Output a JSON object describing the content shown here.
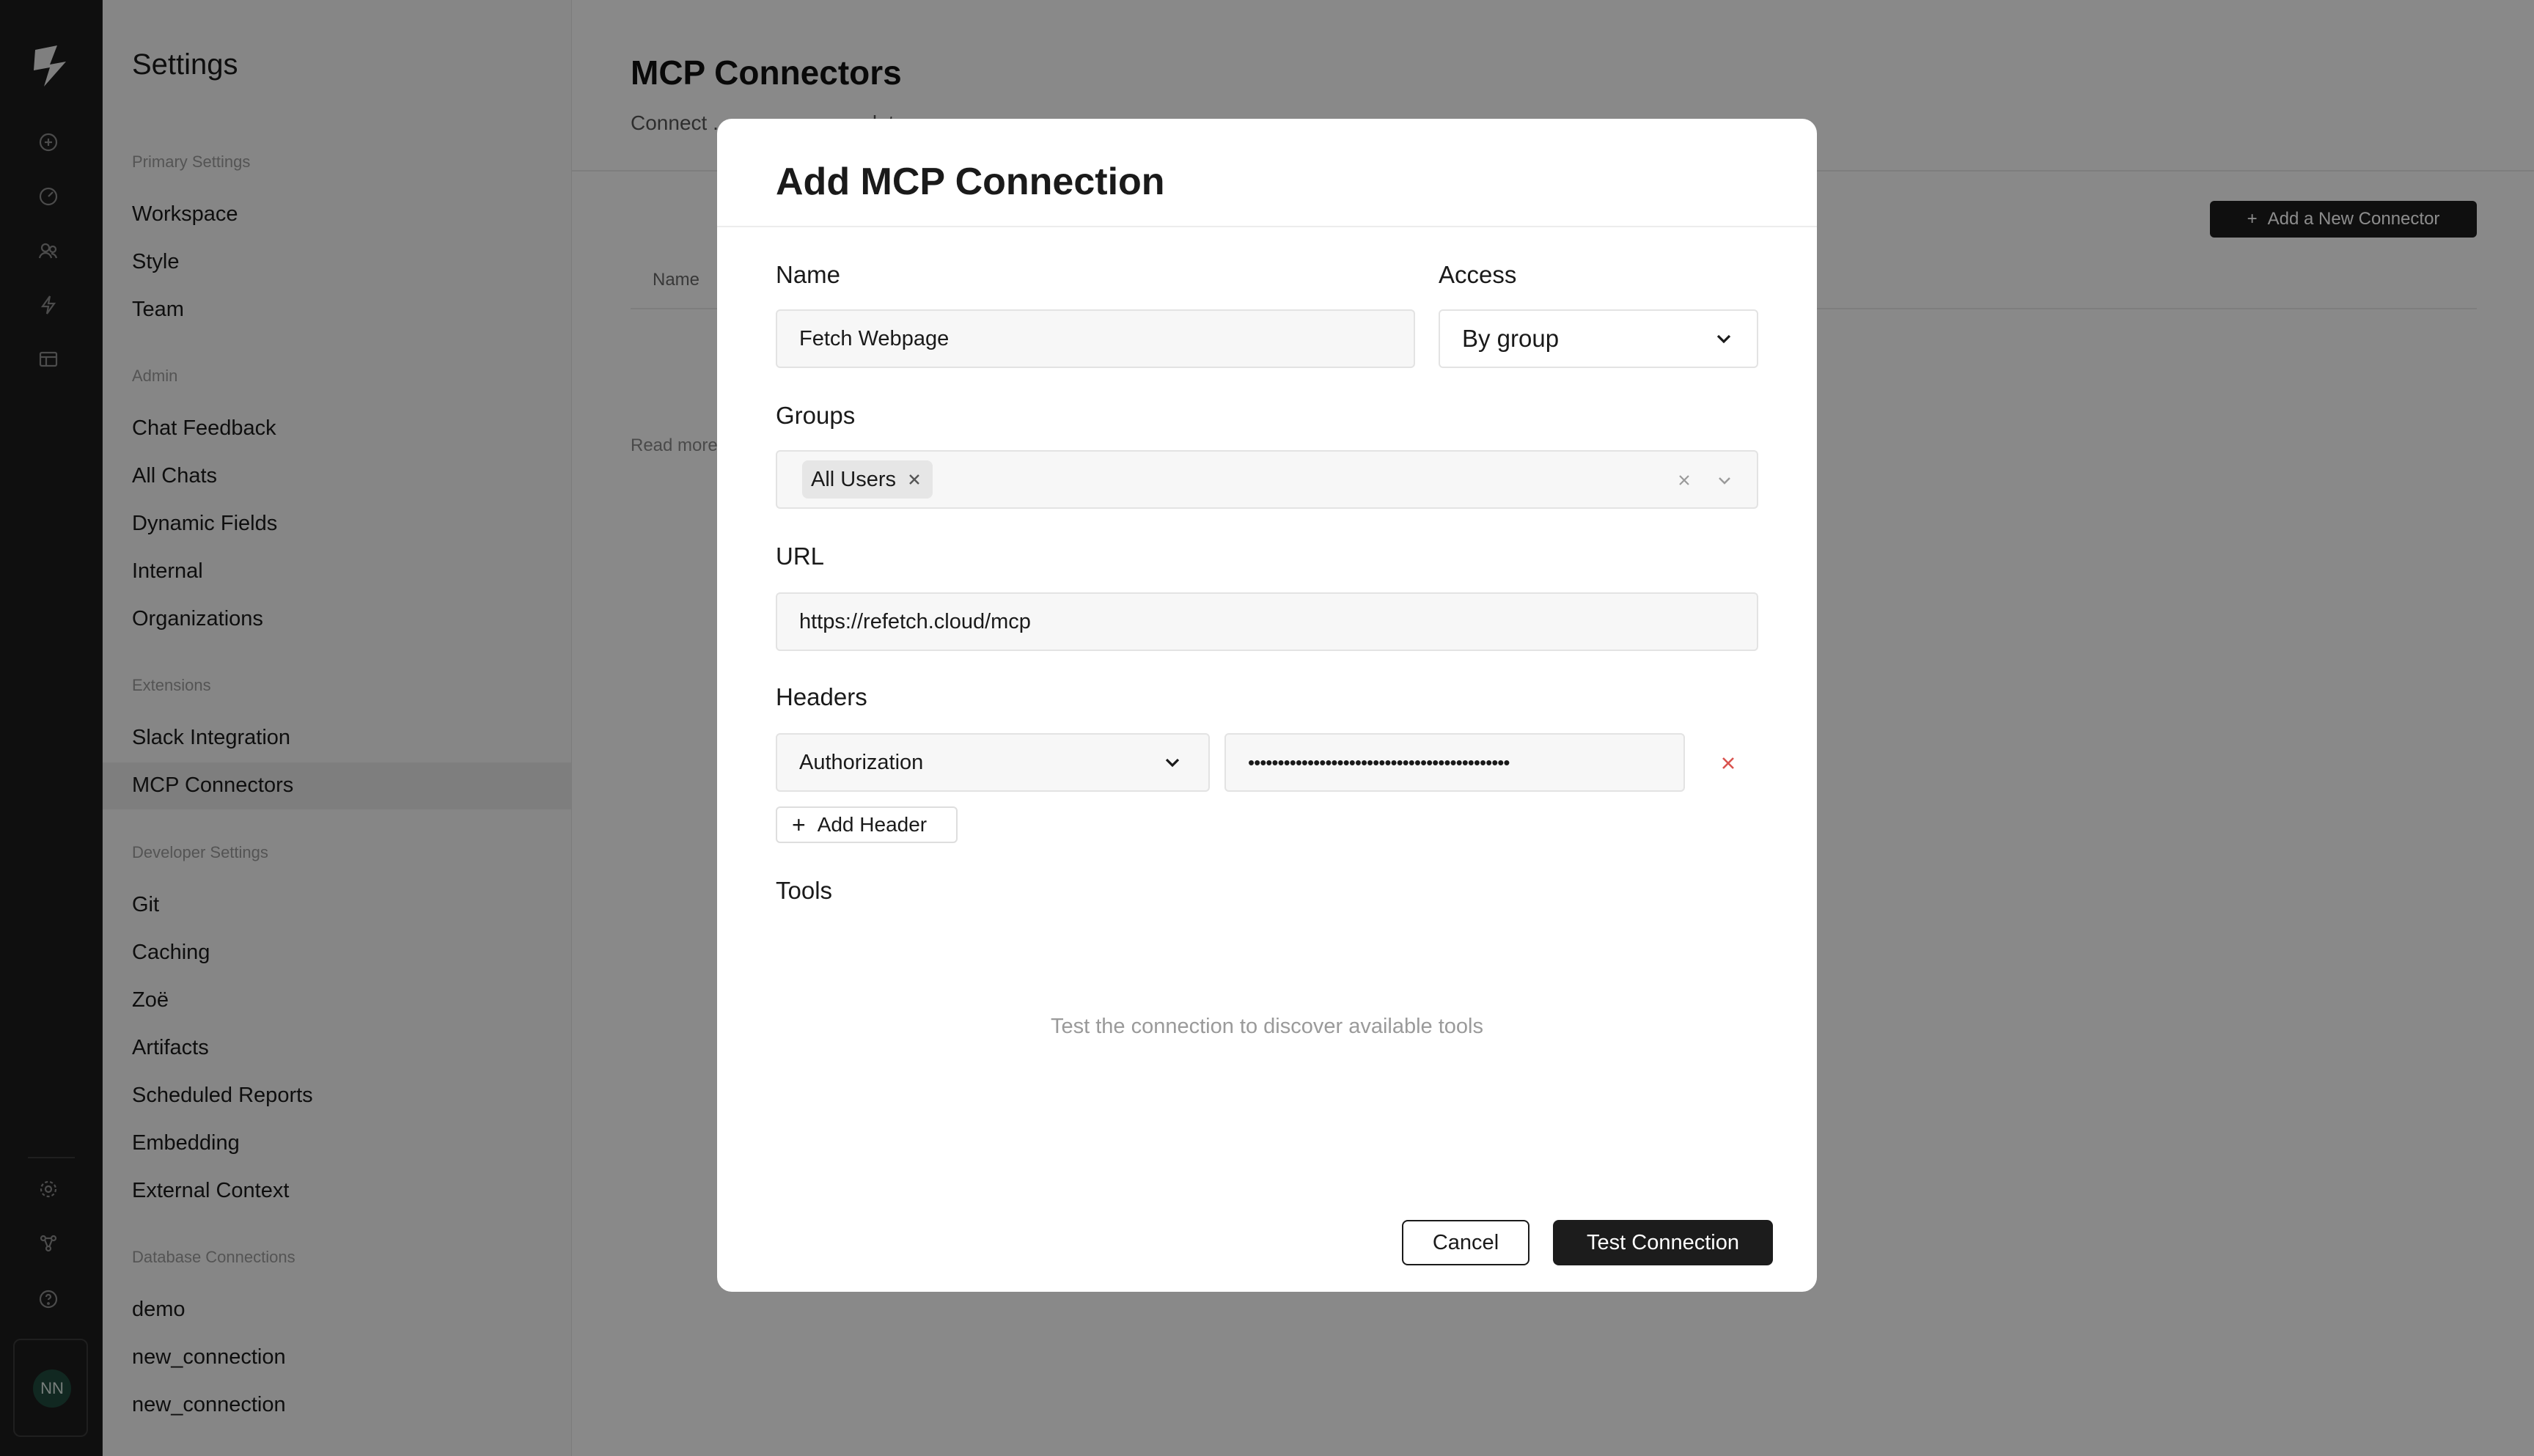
{
  "rail": {
    "icons": [
      "plus-circle-icon",
      "dashboard-icon",
      "users-icon",
      "lightning-icon",
      "table-icon",
      "gear-icon",
      "network-icon",
      "help-icon"
    ],
    "avatar_initials": "NN"
  },
  "sidebar": {
    "title": "Settings",
    "sections": [
      {
        "label": "Primary Settings",
        "items": [
          "Workspace",
          "Style",
          "Team"
        ]
      },
      {
        "label": "Admin",
        "items": [
          "Chat Feedback",
          "All Chats",
          "Dynamic Fields",
          "Internal",
          "Organizations"
        ]
      },
      {
        "label": "Extensions",
        "items": [
          "Slack Integration",
          "MCP Connectors"
        ]
      },
      {
        "label": "Developer Settings",
        "items": [
          "Git",
          "Caching",
          "Zoë",
          "Artifacts",
          "Scheduled Reports",
          "Embedding",
          "External Context"
        ]
      },
      {
        "label": "Database Connections",
        "items": [
          "demo",
          "new_connection",
          "new_connection"
        ]
      }
    ],
    "active_item": "MCP Connectors"
  },
  "main": {
    "title": "MCP Connectors",
    "subtitle": "Connect ... ... ... ...re complete answers.",
    "add_button": "Add a New Connector",
    "column_name": "Name",
    "read_more": "Read more"
  },
  "modal": {
    "title": "Add MCP Connection",
    "name_label": "Name",
    "name_value": "Fetch Webpage",
    "access_label": "Access",
    "access_value": "By group",
    "groups_label": "Groups",
    "group_chip": "All Users",
    "url_label": "URL",
    "url_value": "https://refetch.cloud/mcp",
    "headers_label": "Headers",
    "header_key": "Authorization",
    "header_value_masked": "••••••••••••••••••••••••••••••••••••••••••••",
    "add_header": "Add Header",
    "tools_label": "Tools",
    "tools_empty": "Test the connection to discover available tools",
    "cancel": "Cancel",
    "test": "Test Connection",
    "danger_color": "#d9534f"
  }
}
